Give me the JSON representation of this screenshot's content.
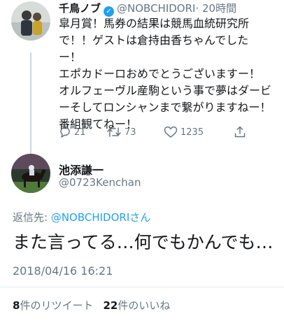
{
  "tweet1": {
    "name": "千鳥ノブ",
    "handle": "@NOBCHIDORI",
    "time": "· 20時間",
    "lines": [
      "皐月賞！馬券の結果は競馬血統研究所",
      "で！！ゲストは倉持由香ちゃんでした",
      "ー！",
      "エポカドーロおめでとうございますー！",
      "オルフェーヴル産駒という事で夢はダービ",
      "ーそしてロンシャンまで繋がりますねー！",
      "番組観てねー！"
    ],
    "reply_count": "21",
    "retweet_count": "73",
    "like_count": "1235"
  },
  "tweet2": {
    "name": "池添謙一",
    "handle": "@0723Kenchan",
    "replying_label": "返信先: ",
    "replying_mention": "@NOBCHIDORI",
    "replying_suffix": "さん",
    "body": "また言ってる…何でもかんでも…",
    "datetime": "2018/04/16 16:21",
    "retweet_num": "8",
    "retweet_label": "件のリツイート",
    "like_num": "22",
    "like_label": "件のいいね"
  },
  "colors": {
    "accent": "#1da1f2",
    "secondary_text": "#657786",
    "divider": "#e6ecf0"
  },
  "icons": [
    "reply-icon",
    "retweet-icon",
    "like-icon",
    "share-icon",
    "verified-badge-icon"
  ]
}
